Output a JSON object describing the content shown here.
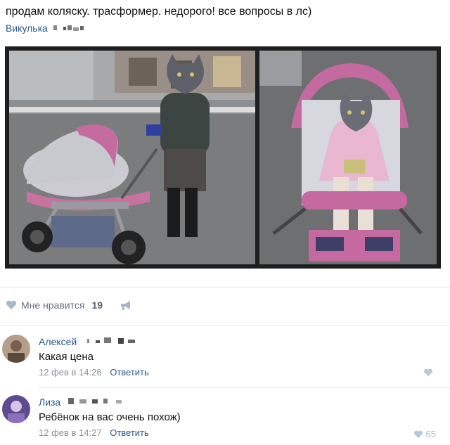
{
  "post": {
    "text": "продам коляску. трасформер. недорого! все вопросы в лс)",
    "author": "Викулька",
    "author_emoji": "▘ ▗▞▝"
  },
  "likes": {
    "label": "Мне нравится",
    "count": "19",
    "like_icon": "heart-icon",
    "share_icon": "megaphone-icon"
  },
  "comments": [
    {
      "author": "Алексей",
      "text": "Какая цена",
      "date": "12 фев в 14:26",
      "reply": "Ответить",
      "likes": ""
    },
    {
      "author": "Лиза",
      "text": "Ребёнок на вас очень похож)",
      "date": "12 фев в 14:27",
      "reply": "Ответить",
      "likes": "65"
    }
  ],
  "colors": {
    "link": "#2a5885",
    "stroller_pink": "#c86a9c",
    "stroller_gray": "#c5c6cc"
  }
}
